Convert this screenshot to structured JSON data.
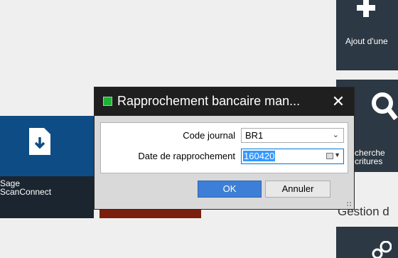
{
  "tiles": {
    "ajout": {
      "label": "Ajout d'une"
    },
    "recherche": {
      "label_line1": "cherche",
      "label_line2": "critures"
    },
    "scanconnect": {
      "label_line1": "Sage",
      "label_line2": "ScanConnect"
    }
  },
  "section": {
    "heading": "Gestion d"
  },
  "dialog": {
    "title": "Rapprochement bancaire man...",
    "close_glyph": "✕",
    "code_journal": {
      "label": "Code journal",
      "value": "BR1"
    },
    "date_rapprochement": {
      "label": "Date de rapprochement",
      "value": "160420"
    },
    "ok_label": "OK",
    "cancel_label": "Annuler"
  }
}
